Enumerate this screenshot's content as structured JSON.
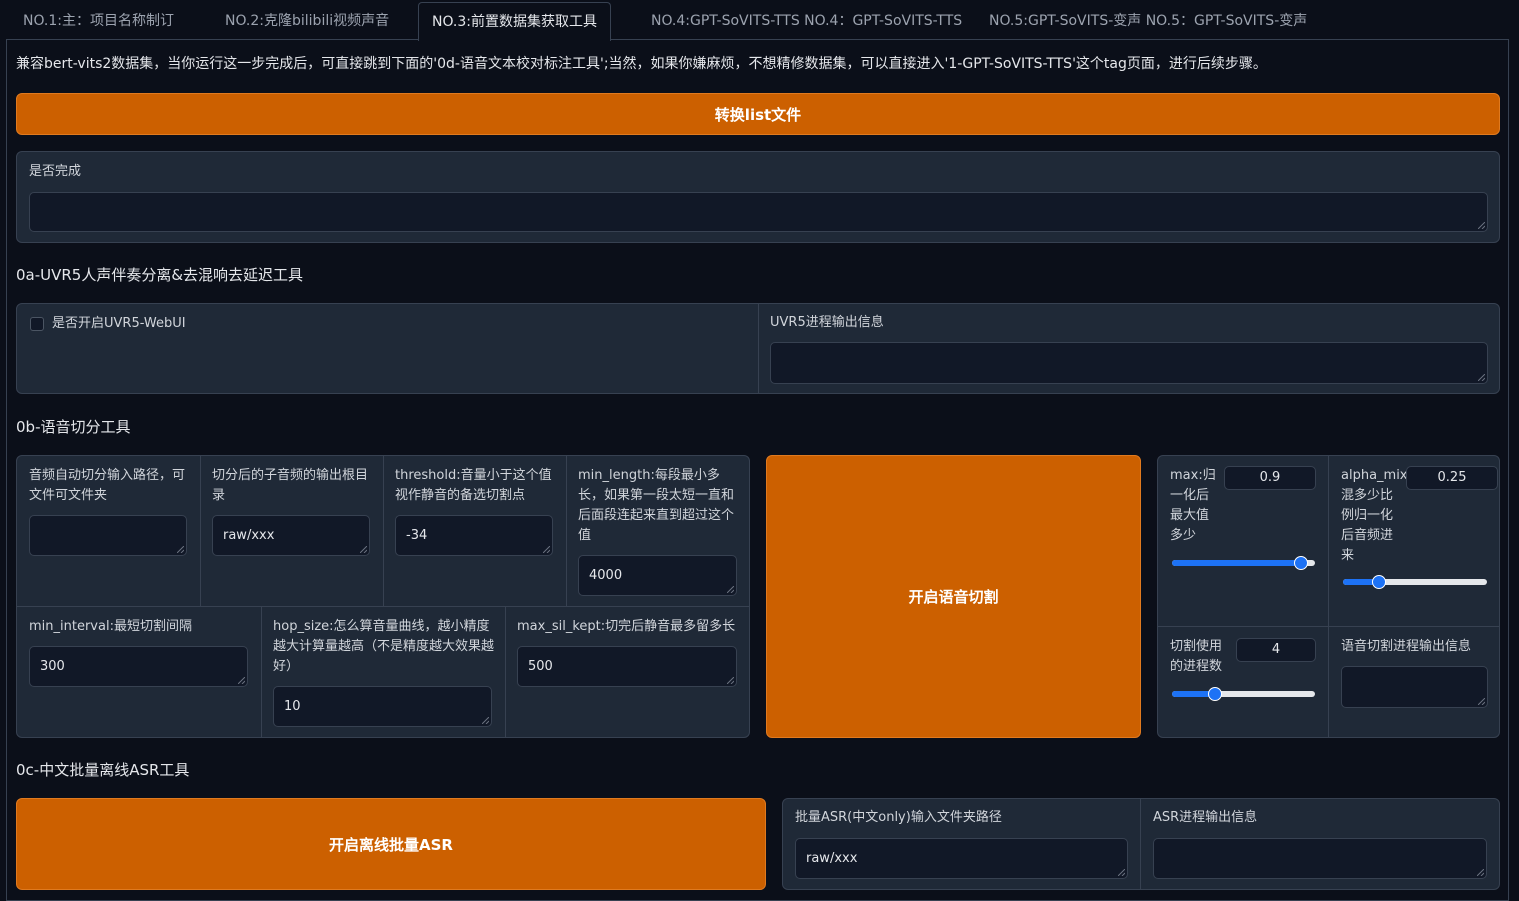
{
  "tabs": [
    {
      "label": "NO.1:主：项目名称制订"
    },
    {
      "label": "NO.2:克隆bilibili视频声音"
    },
    {
      "label": "NO.3:前置数据集获取工具"
    },
    {
      "label": "NO.4:GPT-SoVITS-TTS NO.4：GPT-SoVITS-TTS"
    },
    {
      "label": "NO.5:GPT-SoVITS-变声 NO.5：GPT-SoVITS-变声"
    }
  ],
  "intro_text": "兼容bert-vits2数据集，当你运行这一步完成后，可直接跳到下面的'0d-语音文本校对标注工具';当然，如果你嫌麻烦，不想精修数据集，可以直接进入'1-GPT-SoVITS-TTS'这个tag页面，进行后续步骤。",
  "convert_button": "转换list文件",
  "done": {
    "label": "是否完成",
    "value": ""
  },
  "uvr5": {
    "title": "0a-UVR5人声伴奏分离&去混响去延迟工具",
    "checkbox_label": "是否开启UVR5-WebUI",
    "output_label": "UVR5进程输出信息",
    "output_value": ""
  },
  "slicer": {
    "title": "0b-语音切分工具",
    "input_path_label": "音频自动切分输入路径，可文件可文件夹",
    "input_path_value": "",
    "output_dir_label": "切分后的子音频的输出根目录",
    "output_dir_value": "raw/xxx",
    "threshold_label": "threshold:音量小于这个值视作静音的备选切割点",
    "threshold_value": "-34",
    "min_length_label": "min_length:每段最小多长，如果第一段太短一直和后面段连起来直到超过这个值",
    "min_length_value": "4000",
    "min_interval_label": "min_interval:最短切割间隔",
    "min_interval_value": "300",
    "hop_size_label": "hop_size:怎么算音量曲线，越小精度越大计算量越高（不是精度越大效果越好）",
    "hop_size_value": "10",
    "max_sil_label": "max_sil_kept:切完后静音最多留多长",
    "max_sil_value": "500",
    "start_button": "开启语音切割",
    "max_label": "max:归一化后最大值多少",
    "max_value": "0.9",
    "max_fraction": 0.9,
    "alpha_label": "alpha_mix:混多少比例归一化后音频进来",
    "alpha_value": "0.25",
    "alpha_fraction": 0.25,
    "procs_label": "切割使用的进程数",
    "procs_value": "4",
    "procs_fraction": 0.3,
    "output_label": "语音切割进程输出信息",
    "output_value": ""
  },
  "asr": {
    "title": "0c-中文批量离线ASR工具",
    "start_button": "开启离线批量ASR",
    "input_label": "批量ASR(中文only)输入文件夹路径",
    "input_value": "raw/xxx",
    "output_label": "ASR进程输出信息",
    "output_value": ""
  },
  "colors": {
    "accent": "#cc6000",
    "slider": "#1d72f5",
    "panel": "#1f2937",
    "background": "#0b0f19"
  }
}
